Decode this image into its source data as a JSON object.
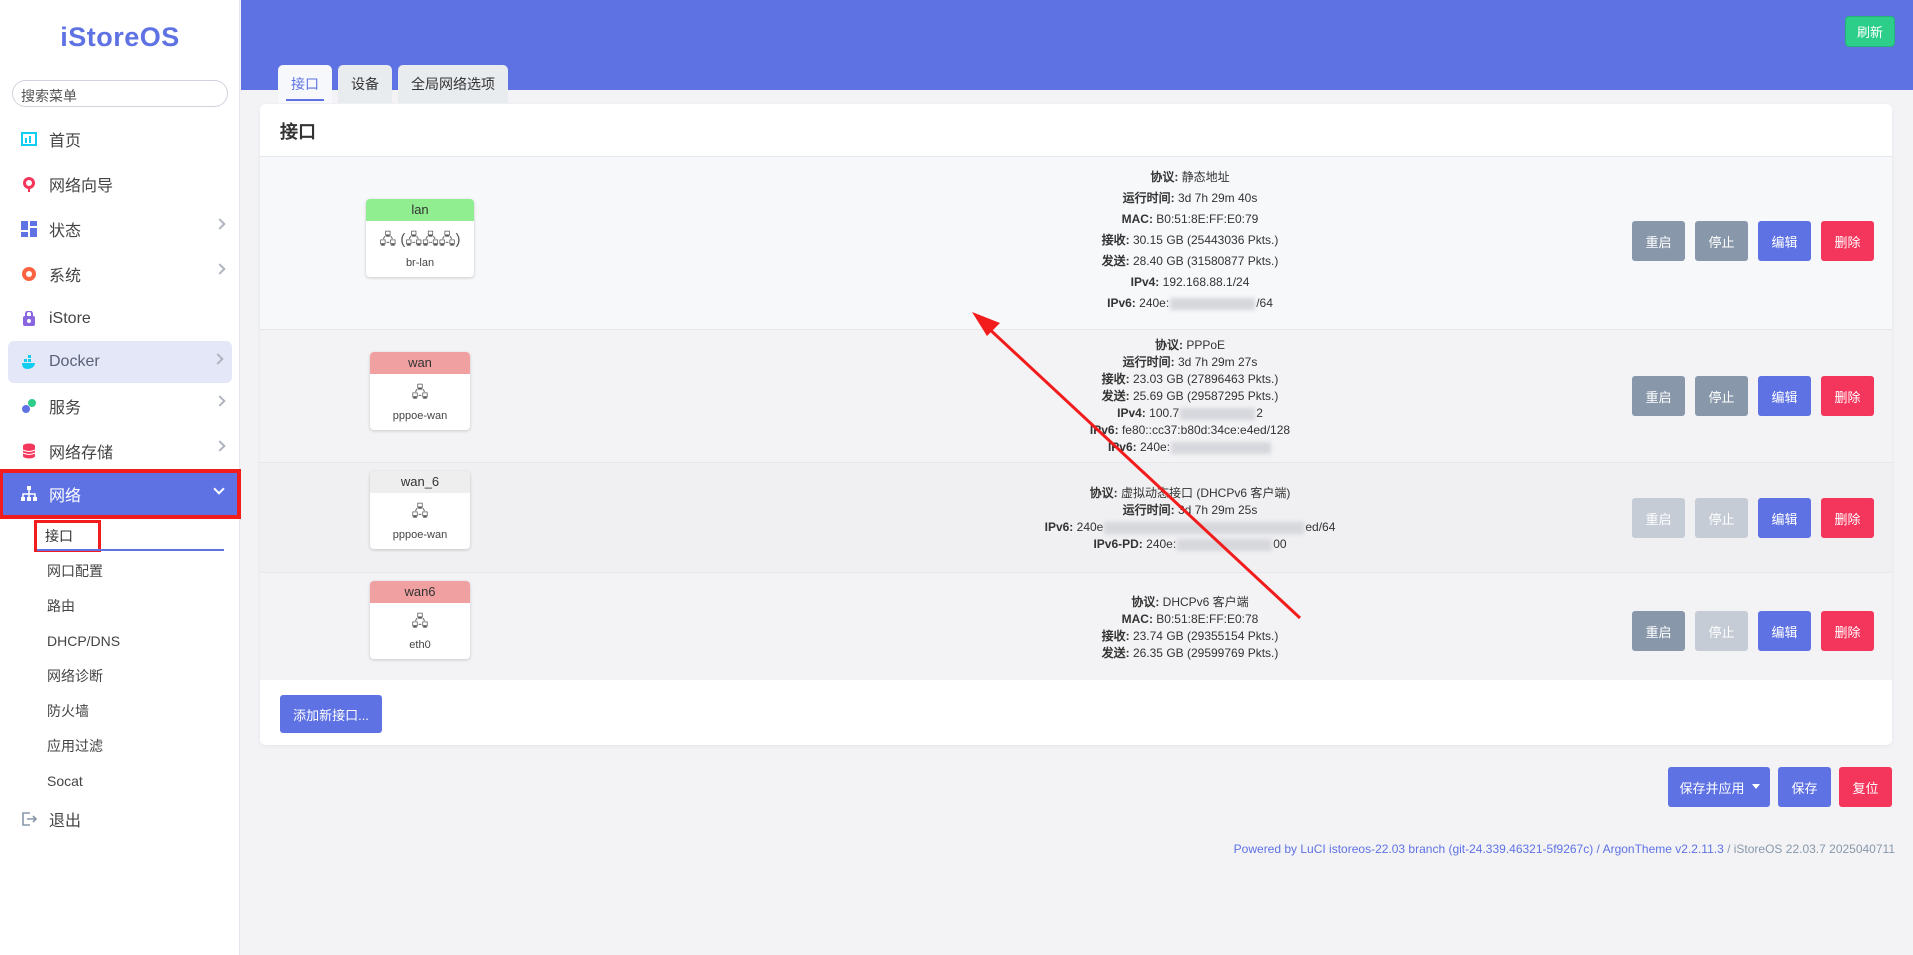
{
  "brand": "iStoreOS",
  "search_placeholder": "搜索菜单",
  "menu": [
    {
      "label": "首页",
      "icon": "chart-icon",
      "color": "#11cdef"
    },
    {
      "label": "网络向导",
      "icon": "globe-icon",
      "color": "#f5365c"
    },
    {
      "label": "状态",
      "icon": "dashboard-icon",
      "color": "#5e72e4"
    },
    {
      "label": "系统",
      "icon": "gear-icon",
      "color": "#fb6340"
    },
    {
      "label": "iStore",
      "icon": "store-icon",
      "color": "#8965e0"
    },
    {
      "label": "Docker",
      "icon": "docker-icon",
      "color": "#11cdef"
    },
    {
      "label": "服务",
      "icon": "puzzle-icon",
      "color": "#5e72e4"
    },
    {
      "label": "网络存储",
      "icon": "database-icon",
      "color": "#f5365c"
    },
    {
      "label": "网络",
      "icon": "network-icon",
      "color": "#ffffff"
    }
  ],
  "submenu": [
    "接口",
    "网口配置",
    "路由",
    "DHCP/DNS",
    "网络诊断",
    "防火墙",
    "应用过滤",
    "Socat"
  ],
  "logout": "退出",
  "refresh": "刷新",
  "tabs": [
    "接口",
    "设备",
    "全局网络选项"
  ],
  "card_title": "接口",
  "interfaces": [
    {
      "name": "lan",
      "header_color": "#90ee90",
      "device": "br-lan",
      "device_icon": "🖧 (🖧🖧🖧)",
      "lines": [
        {
          "k": "协议:",
          "v": "静态地址"
        },
        {
          "k": "运行时间:",
          "v": "3d 7h 29m 40s"
        },
        {
          "k": "MAC:",
          "v": "B0:51:8E:FF:E0:79"
        },
        {
          "k": "接收:",
          "v": "30.15 GB (25443036 Pkts.)"
        },
        {
          "k": "发送:",
          "v": "28.40 GB (31580877 Pkts.)"
        },
        {
          "k": "IPv4:",
          "v": "192.168.88.1/24"
        },
        {
          "k": "IPv6:",
          "v": "240e:",
          "tail": "/64"
        }
      ]
    },
    {
      "name": "wan",
      "header_color": "#f0a0a0",
      "device": "pppoe-wan",
      "device_icon": "🖧",
      "lines": [
        {
          "k": "协议:",
          "v": "PPPoE"
        },
        {
          "k": "运行时间:",
          "v": "3d 7h 29m 27s"
        },
        {
          "k": "接收:",
          "v": "23.03 GB (27896463 Pkts.)"
        },
        {
          "k": "发送:",
          "v": "25.69 GB (29587295 Pkts.)"
        },
        {
          "k": "IPv4:",
          "v": "100.7",
          "tail": "2"
        },
        {
          "k": "IPv6:",
          "v": "fe80::cc37:b80d:34ce:e4ed/128"
        },
        {
          "k": "IPv6:",
          "v": "240e:"
        }
      ]
    },
    {
      "name": "wan_6",
      "header_color": "#eeeeee",
      "device": "pppoe-wan",
      "device_icon": "🖧",
      "lines": [
        {
          "k": "协议:",
          "v": "虚拟动态接口 (DHCPv6 客户端)"
        },
        {
          "k": "运行时间:",
          "v": "3d 7h 29m 25s"
        },
        {
          "k": "IPv6:",
          "v": "240e",
          "tail": "ed/64"
        },
        {
          "k": "IPv6-PD:",
          "v": "240e:",
          "tail": "00"
        }
      ]
    },
    {
      "name": "wan6",
      "header_color": "#f0a0a0",
      "device": "eth0",
      "device_icon": "🖧",
      "lines": [
        {
          "k": "协议:",
          "v": "DHCPv6 客户端"
        },
        {
          "k": "MAC:",
          "v": "B0:51:8E:FF:E0:78"
        },
        {
          "k": "接收:",
          "v": "23.74 GB (29355154 Pkts.)"
        },
        {
          "k": "发送:",
          "v": "26.35 GB (29599769 Pkts.)"
        }
      ]
    }
  ],
  "row_buttons": {
    "restart": "重启",
    "stop": "停止",
    "edit": "编辑",
    "delete": "删除"
  },
  "add_interface": "添加新接口...",
  "save_apply": "保存并应用",
  "save": "保存",
  "reset": "复位",
  "footer": {
    "link": "Powered by LuCI istoreos-22.03 branch (git-24.339.46321-5f9267c) / ArgonTheme v2.2.11.3",
    "tail": " / iStoreOS 22.03.7 2025040711"
  }
}
